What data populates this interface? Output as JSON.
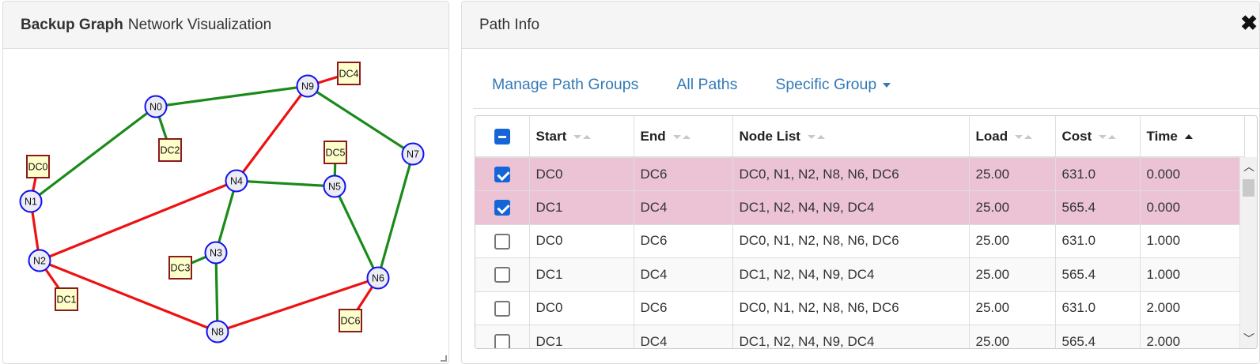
{
  "left_panel": {
    "title_bold": "Backup Graph",
    "title_rest": "Network Visualization"
  },
  "graph": {
    "colors": {
      "red_edge": "#ee1111",
      "green_edge": "#1a8a1a",
      "node_stroke": "#1111ee",
      "node_fill": "#ececf6",
      "dc_fill": "#ffffcc",
      "dc_stroke": "#8b1a1a"
    },
    "nodes": [
      {
        "id": "N0"
      },
      {
        "id": "N1"
      },
      {
        "id": "N2"
      },
      {
        "id": "N3"
      },
      {
        "id": "N4"
      },
      {
        "id": "N5"
      },
      {
        "id": "N6"
      },
      {
        "id": "N7"
      },
      {
        "id": "N8"
      },
      {
        "id": "N9"
      }
    ],
    "dcs": [
      {
        "id": "DC0"
      },
      {
        "id": "DC1"
      },
      {
        "id": "DC2"
      },
      {
        "id": "DC3"
      },
      {
        "id": "DC4"
      },
      {
        "id": "DC5"
      },
      {
        "id": "DC6"
      }
    ],
    "edges": [
      {
        "a": "N0",
        "b": "N9",
        "color": "green"
      },
      {
        "a": "N0",
        "b": "N1",
        "color": "green"
      },
      {
        "a": "N0",
        "b": "DC2",
        "color": "green"
      },
      {
        "a": "N9",
        "b": "N7",
        "color": "green"
      },
      {
        "a": "N9",
        "b": "DC4",
        "color": "red"
      },
      {
        "a": "N9",
        "b": "N4",
        "color": "red"
      },
      {
        "a": "N4",
        "b": "N5",
        "color": "green"
      },
      {
        "a": "N4",
        "b": "N3",
        "color": "green"
      },
      {
        "a": "N4",
        "b": "N2",
        "color": "red"
      },
      {
        "a": "N5",
        "b": "DC5",
        "color": "green"
      },
      {
        "a": "N5",
        "b": "N6",
        "color": "green"
      },
      {
        "a": "N7",
        "b": "N6",
        "color": "green"
      },
      {
        "a": "N1",
        "b": "DC0",
        "color": "red"
      },
      {
        "a": "N1",
        "b": "N2",
        "color": "red"
      },
      {
        "a": "N2",
        "b": "DC1",
        "color": "red"
      },
      {
        "a": "N2",
        "b": "N8",
        "color": "red"
      },
      {
        "a": "N3",
        "b": "DC3",
        "color": "green"
      },
      {
        "a": "N3",
        "b": "N8",
        "color": "green"
      },
      {
        "a": "N8",
        "b": "N6",
        "color": "red"
      },
      {
        "a": "N6",
        "b": "DC6",
        "color": "red"
      }
    ]
  },
  "right_panel": {
    "title": "Path Info",
    "close_icon": "close-icon",
    "tabs": [
      {
        "label": "Manage Path Groups"
      },
      {
        "label": "All Paths"
      },
      {
        "label": "Specific Group",
        "dropdown": true
      }
    ]
  },
  "table": {
    "columns": [
      {
        "label": "Start",
        "sort": "none"
      },
      {
        "label": "End",
        "sort": "none"
      },
      {
        "label": "Node List",
        "sort": "none"
      },
      {
        "label": "Load",
        "sort": "none"
      },
      {
        "label": "Cost",
        "sort": "none"
      },
      {
        "label": "Time",
        "sort": "asc"
      }
    ],
    "header_checkbox": "indeterminate",
    "rows": [
      {
        "checked": true,
        "start": "DC0",
        "end": "DC6",
        "nodes": "DC0, N1, N2, N8, N6, DC6",
        "load": "25.00",
        "cost": "631.0",
        "time": "0.000"
      },
      {
        "checked": true,
        "start": "DC1",
        "end": "DC4",
        "nodes": "DC1, N2, N4, N9, DC4",
        "load": "25.00",
        "cost": "565.4",
        "time": "0.000"
      },
      {
        "checked": false,
        "start": "DC0",
        "end": "DC6",
        "nodes": "DC0, N1, N2, N8, N6, DC6",
        "load": "25.00",
        "cost": "631.0",
        "time": "1.000"
      },
      {
        "checked": false,
        "start": "DC1",
        "end": "DC4",
        "nodes": "DC1, N2, N4, N9, DC4",
        "load": "25.00",
        "cost": "565.4",
        "time": "1.000"
      },
      {
        "checked": false,
        "start": "DC0",
        "end": "DC6",
        "nodes": "DC0, N1, N2, N8, N6, DC6",
        "load": "25.00",
        "cost": "631.0",
        "time": "2.000"
      },
      {
        "checked": false,
        "start": "DC1",
        "end": "DC4",
        "nodes": "DC1, N2, N4, N9, DC4",
        "load": "25.00",
        "cost": "565.4",
        "time": "2.000"
      }
    ],
    "selected_row_color": "#ebc3d4"
  }
}
